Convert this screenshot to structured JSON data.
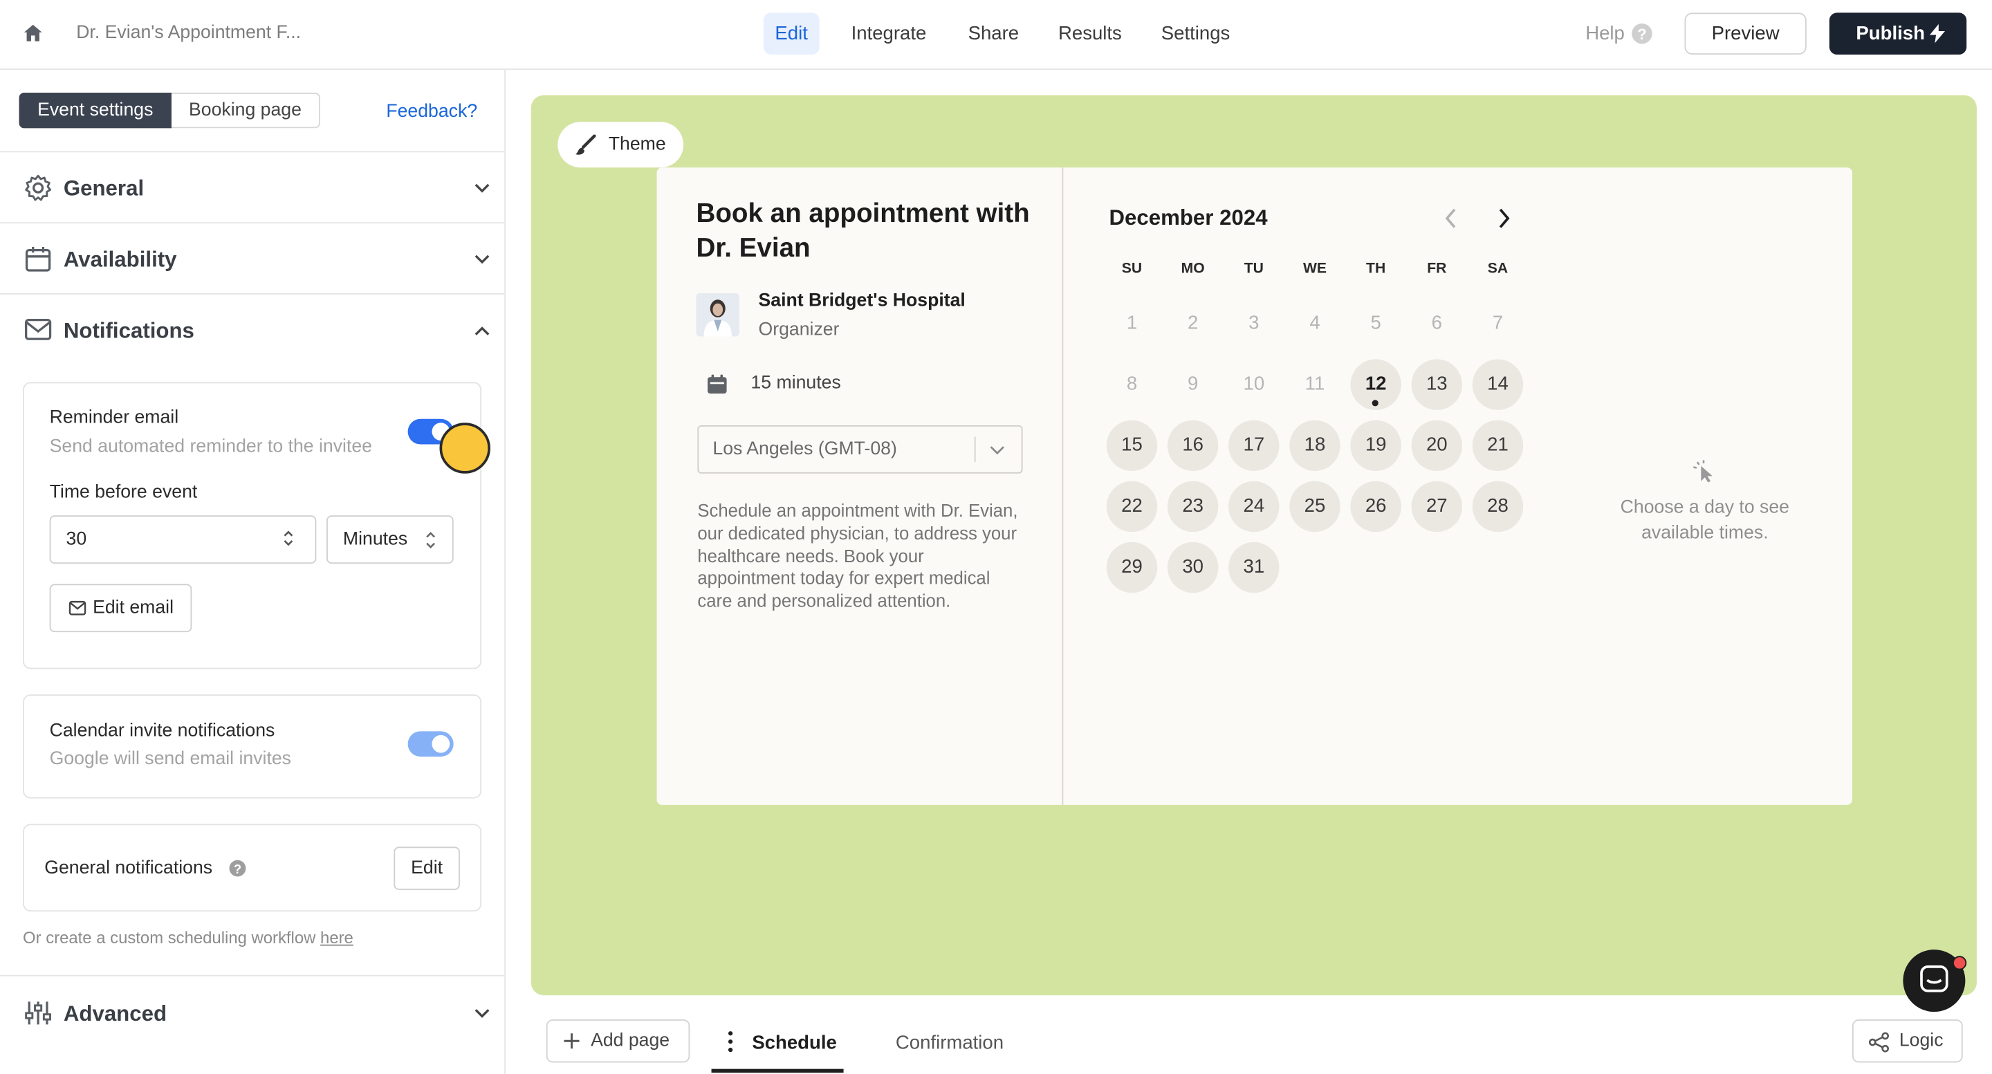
{
  "header": {
    "breadcrumb": "Dr. Evian's Appointment F...",
    "tabs": [
      "Edit",
      "Integrate",
      "Share",
      "Results",
      "Settings"
    ],
    "active_tab": "Edit",
    "help_label": "Help",
    "preview_label": "Preview",
    "publish_label": "Publish"
  },
  "sidebar": {
    "segments": [
      "Event settings",
      "Booking page"
    ],
    "active_segment": "Event settings",
    "feedback_label": "Feedback?",
    "sections": {
      "general": "General",
      "availability": "Availability",
      "notifications": "Notifications",
      "advanced": "Advanced"
    },
    "reminder": {
      "title": "Reminder email",
      "description": "Send automated reminder to the invitee",
      "enabled": true,
      "time_label": "Time before event",
      "time_value": "30",
      "unit_value": "Minutes",
      "edit_email_label": "Edit email"
    },
    "calendar_invite": {
      "title": "Calendar invite notifications",
      "description": "Google will send email invites",
      "enabled": true
    },
    "general_notifications": {
      "title": "General notifications",
      "edit_label": "Edit"
    },
    "custom_workflow": {
      "text": "Or create a custom scheduling workflow",
      "link": "here"
    }
  },
  "canvas": {
    "theme_label": "Theme",
    "colors": {
      "background": "#d3e4a1",
      "card": "#fbfaf7",
      "accent": "#1a66d9"
    },
    "booking": {
      "title": "Book an appointment with Dr. Evian",
      "organization": "Saint Bridget's Hospital",
      "organizer_role": "Organizer",
      "duration": "15 minutes",
      "timezone": "Los Angeles (GMT-08)",
      "description": "Schedule an appointment with Dr. Evian, our dedicated physician, to address your healthcare needs. Book your appointment today for expert medical care and personalized attention."
    },
    "calendar": {
      "month_label": "December 2024",
      "weekdays": [
        "SU",
        "MO",
        "TU",
        "WE",
        "TH",
        "FR",
        "SA"
      ],
      "days": [
        [
          "1",
          "2",
          "3",
          "4",
          "5",
          "6",
          "7"
        ],
        [
          "8",
          "9",
          "10",
          "11",
          "12",
          "13",
          "14"
        ],
        [
          "15",
          "16",
          "17",
          "18",
          "19",
          "20",
          "21"
        ],
        [
          "22",
          "23",
          "24",
          "25",
          "26",
          "27",
          "28"
        ],
        [
          "29",
          "30",
          "31"
        ]
      ],
      "today": "12",
      "first_available": "12",
      "empty_state_line1": "Choose a day to see",
      "empty_state_line2": "available times."
    }
  },
  "footer": {
    "add_page_label": "Add page",
    "pages": [
      "Schedule",
      "Confirmation"
    ],
    "active_page": "Schedule",
    "logic_label": "Logic"
  }
}
